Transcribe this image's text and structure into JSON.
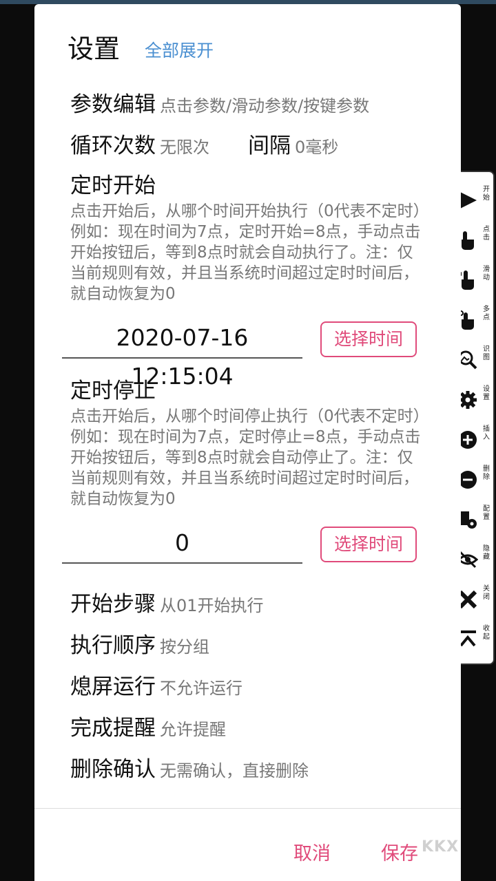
{
  "dialog": {
    "title": "设置",
    "expand_all": "全部展开",
    "rows": {
      "param": {
        "label": "参数编辑",
        "value": "点击参数/滑动参数/按键参数"
      },
      "loop": {
        "label": "循环次数",
        "value": "无限次"
      },
      "interval": {
        "label": "间隔",
        "value": "0毫秒"
      }
    },
    "timed_start": {
      "label": "定时开始",
      "desc": "点击开始后，从哪个时间开始执行（0代表不定时）例如：现在时间为7点，定时开始=8点，手动点击开始按钮后，等到8点时就会自动执行了。注：仅当前规则有效，并且当系统时间超过定时时间后，就自动恢复为0",
      "value": "2020-07-16 12:15:04",
      "button": "选择时间"
    },
    "timed_stop": {
      "label": "定时停止",
      "desc": "点击开始后，从哪个时间停止执行（0代表不定时）例如：现在时间为7点，定时停止=8点，手动点击开始按钮后，等到8点时就会自动停止了。注：仅当前规则有效，并且当系统时间超过定时时间后，就自动恢复为0",
      "value": "0",
      "button": "选择时间"
    },
    "options": [
      {
        "label": "开始步骤",
        "value": "从01开始执行"
      },
      {
        "label": "执行顺序",
        "value": "按分组"
      },
      {
        "label": "熄屏运行",
        "value": "不允许运行"
      },
      {
        "label": "完成提醒",
        "value": "允许提醒"
      },
      {
        "label": "删除确认",
        "value": "无需确认，直接删除"
      }
    ],
    "cancel": "取消",
    "save": "保存"
  },
  "sidebar": {
    "items": [
      {
        "label": "开始",
        "icon": "play-icon"
      },
      {
        "label": "点击",
        "icon": "tap-hand-icon"
      },
      {
        "label": "滑动",
        "icon": "swipe-hand-icon"
      },
      {
        "label": "多点",
        "icon": "multi-touch-icon"
      },
      {
        "label": "识图",
        "icon": "image-search-icon"
      },
      {
        "label": "设置",
        "icon": "gear-icon"
      },
      {
        "label": "插入",
        "icon": "plus-circle-icon"
      },
      {
        "label": "删除",
        "icon": "minus-circle-icon"
      },
      {
        "label": "配置",
        "icon": "config-icon"
      },
      {
        "label": "隐藏",
        "icon": "eye-off-icon"
      },
      {
        "label": "关闭",
        "icon": "close-icon"
      },
      {
        "label": "收起",
        "icon": "collapse-icon"
      }
    ]
  },
  "watermark": "KKX"
}
